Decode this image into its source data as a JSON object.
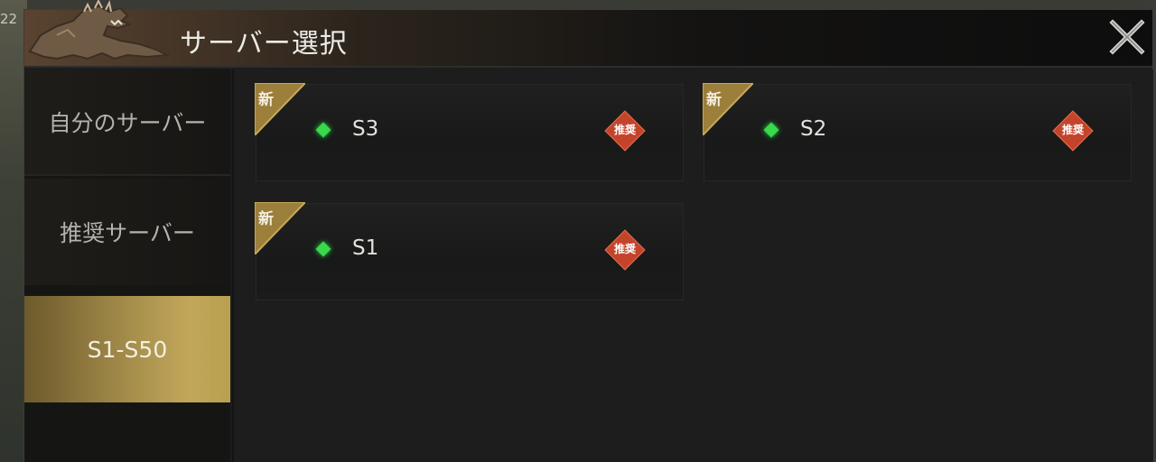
{
  "background": {
    "corner_number": "22"
  },
  "header": {
    "title": "サーバー選択",
    "close_icon": "close-icon"
  },
  "sidebar": {
    "tabs": [
      {
        "label": "自分のサーバー",
        "active": false
      },
      {
        "label": "推奨サーバー",
        "active": false
      },
      {
        "label": "S1-S50",
        "active": true
      }
    ]
  },
  "servers": [
    {
      "name": "S3",
      "corner_label": "新",
      "badge": "推奨",
      "status": "online"
    },
    {
      "name": "S2",
      "corner_label": "新",
      "badge": "推奨",
      "status": "online"
    },
    {
      "name": "S1",
      "corner_label": "新",
      "badge": "推奨",
      "status": "online"
    }
  ],
  "colors": {
    "accent_gold": "#b8a050",
    "status_online": "#38d94a",
    "badge_red": "#c4442b"
  }
}
